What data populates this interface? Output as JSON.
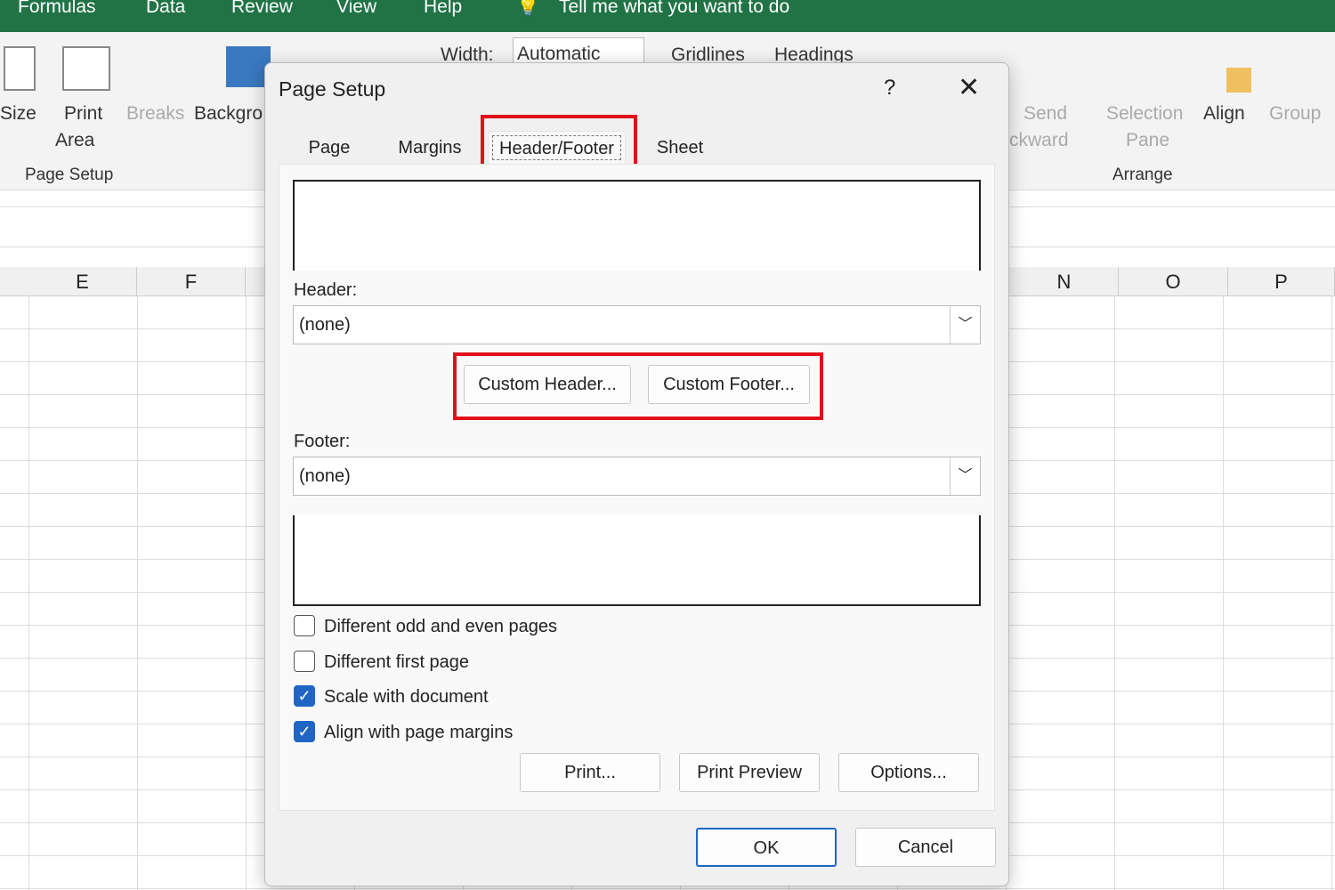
{
  "menu": {
    "tabs": [
      "Formulas",
      "Data",
      "Review",
      "View",
      "Help"
    ],
    "tell_me": "Tell me what you want to do"
  },
  "ribbon": {
    "size": "Size",
    "print_area_1": "Print",
    "print_area_2": "Area",
    "breaks": "Breaks",
    "background": "Backgro",
    "width_label": "Width:",
    "width_value": "Automatic",
    "gridlines": "Gridlines",
    "headings": "Headings",
    "send_1": "Send",
    "send_2": "ckward",
    "selection_1": "Selection",
    "selection_2": "Pane",
    "align": "Align",
    "group": "Group",
    "group_page_setup": "Page Setup",
    "group_arrange": "Arrange"
  },
  "columns": [
    "E",
    "F",
    "N",
    "O",
    "P"
  ],
  "dialog": {
    "title": "Page Setup",
    "help": "?",
    "close": "✕",
    "tabs": [
      "Page",
      "Margins",
      "Header/Footer",
      "Sheet"
    ],
    "active_tab": "Header/Footer",
    "header_label": "Header:",
    "header_value": "(none)",
    "custom_header": "Custom Header...",
    "custom_footer": "Custom Footer...",
    "footer_label": "Footer:",
    "footer_value": "(none)",
    "checkboxes": [
      {
        "label": "Different odd and even pages",
        "checked": false
      },
      {
        "label": "Different first page",
        "checked": false
      },
      {
        "label": "Scale with document",
        "checked": true
      },
      {
        "label": "Align with page margins",
        "checked": true
      }
    ],
    "print": "Print...",
    "print_preview": "Print Preview",
    "options": "Options...",
    "ok": "OK",
    "cancel": "Cancel"
  },
  "colors": {
    "excel_green": "#217346",
    "highlight": "#e0101a",
    "checkbox": "#1f66c4"
  }
}
